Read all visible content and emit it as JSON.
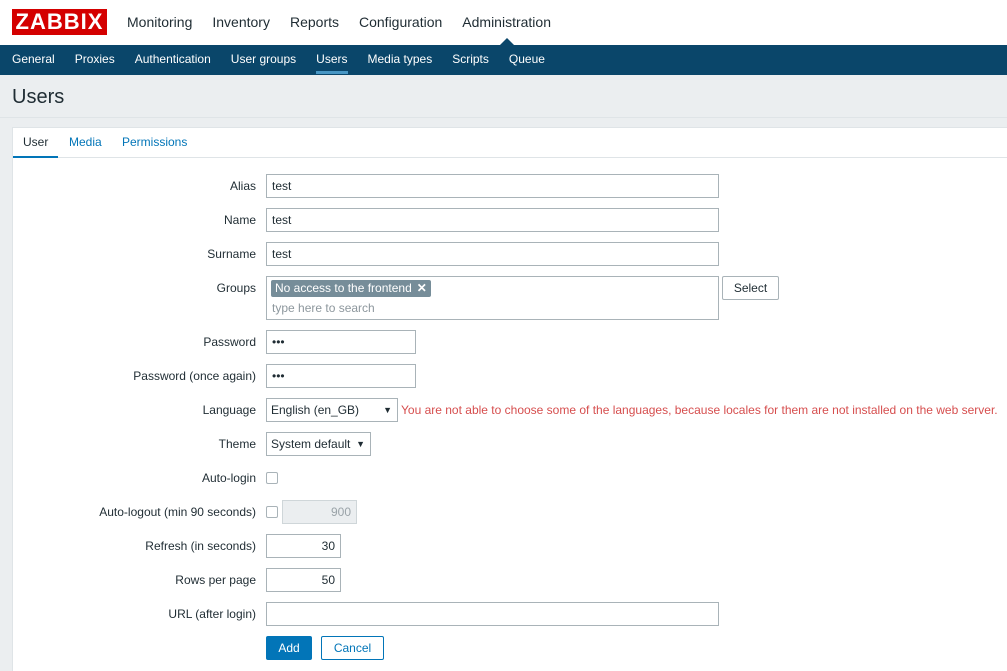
{
  "app": {
    "logo": "ZABBIX"
  },
  "top_menu": [
    {
      "label": "Monitoring"
    },
    {
      "label": "Inventory"
    },
    {
      "label": "Reports"
    },
    {
      "label": "Configuration"
    },
    {
      "label": "Administration",
      "active": true
    }
  ],
  "sub_menu": [
    {
      "label": "General"
    },
    {
      "label": "Proxies"
    },
    {
      "label": "Authentication"
    },
    {
      "label": "User groups"
    },
    {
      "label": "Users",
      "active": true
    },
    {
      "label": "Media types"
    },
    {
      "label": "Scripts"
    },
    {
      "label": "Queue"
    }
  ],
  "page": {
    "title": "Users"
  },
  "tabs": [
    {
      "label": "User",
      "active": true
    },
    {
      "label": "Media"
    },
    {
      "label": "Permissions"
    }
  ],
  "form": {
    "alias": {
      "label": "Alias",
      "value": "test"
    },
    "name": {
      "label": "Name",
      "value": "test"
    },
    "surname": {
      "label": "Surname",
      "value": "test"
    },
    "groups": {
      "label": "Groups",
      "chip": "No access to the frontend",
      "placeholder": "type here to search",
      "select_button": "Select"
    },
    "password": {
      "label": "Password",
      "value": "•••"
    },
    "password2": {
      "label": "Password (once again)",
      "value": "•••"
    },
    "language": {
      "label": "Language",
      "value": "English (en_GB)",
      "warning": "You are not able to choose some of the languages, because locales for them are not installed on the web server."
    },
    "theme": {
      "label": "Theme",
      "value": "System default"
    },
    "autologin": {
      "label": "Auto-login",
      "checked": false
    },
    "autologout": {
      "label": "Auto-logout (min 90 seconds)",
      "checked": false,
      "value": "900"
    },
    "refresh": {
      "label": "Refresh (in seconds)",
      "value": "30"
    },
    "rows_per_page": {
      "label": "Rows per page",
      "value": "50"
    },
    "url": {
      "label": "URL (after login)",
      "value": ""
    },
    "add_button": "Add",
    "cancel_button": "Cancel"
  },
  "colors": {
    "brand": "#d40000",
    "nav": "#0a466a",
    "accent": "#0275b8",
    "error": "#d64e4e",
    "chip": "#768d99"
  }
}
